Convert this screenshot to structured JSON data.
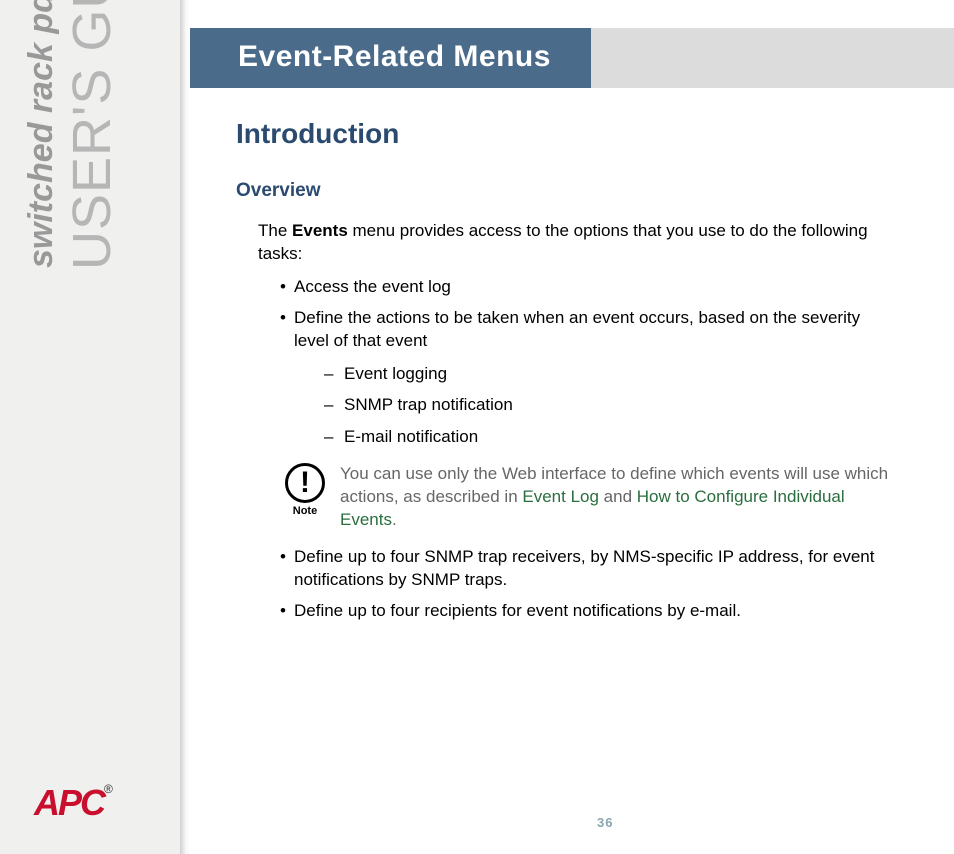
{
  "sidebar": {
    "title_main": "USER'S GUIDE",
    "title_sub": "switched rack pdu",
    "logo_text": "APC",
    "logo_reg": "®"
  },
  "header": {
    "title": "Event-Related Menus"
  },
  "content": {
    "section_title": "Introduction",
    "subsection_title": "Overview",
    "intro_pre": "The ",
    "intro_bold": "Events",
    "intro_post": " menu provides access to the options that you use to do the following tasks:",
    "bullets_a": {
      "0": "Access the event log",
      "1": "Define the actions to be taken when an event occurs, based on the severity level of that event"
    },
    "dashes": {
      "0": "Event logging",
      "1": "SNMP trap notification",
      "2": "E-mail notification"
    },
    "note": {
      "label": "Note",
      "text_pre": "You can use only the Web interface to define which events will use which actions, as described in ",
      "link1": "Event Log",
      "mid": " and ",
      "link2": "How to Configure Individual Events",
      "post": "."
    },
    "bullets_b": {
      "0": "Define up to four SNMP trap receivers, by NMS-specific IP address, for event notifications by SNMP traps.",
      "1": "Define up to four recipients for event notifications by e-mail."
    }
  },
  "page_number": "36"
}
